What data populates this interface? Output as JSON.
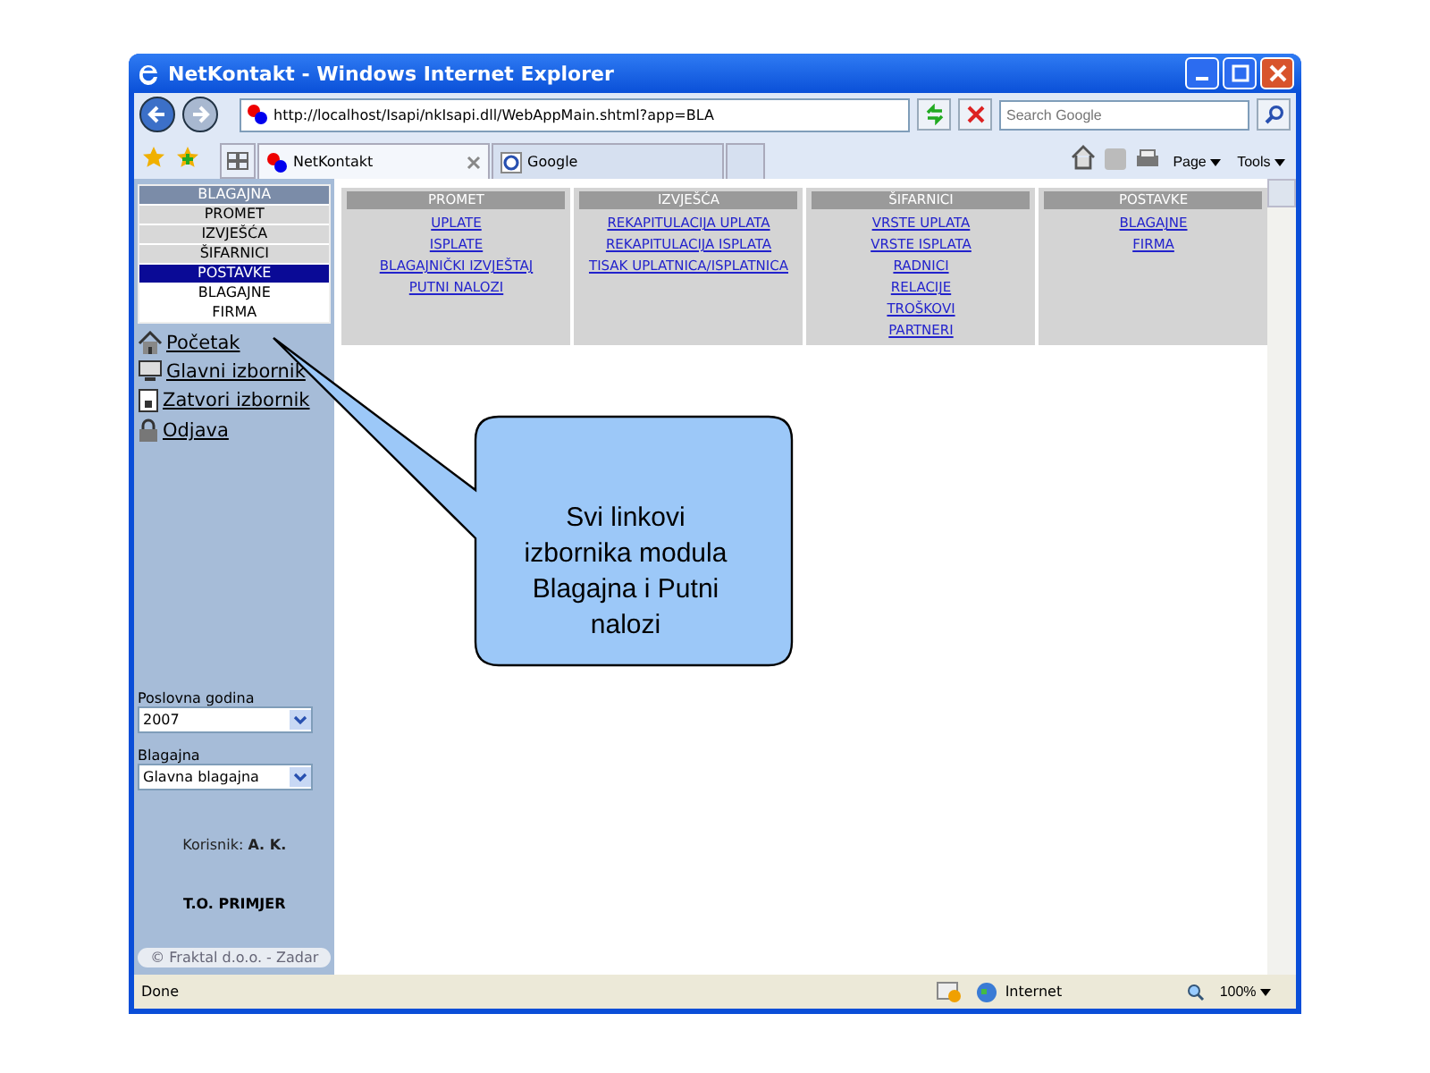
{
  "window": {
    "title": "NetKontakt - Windows Internet Explorer"
  },
  "address_bar": {
    "url": "http://localhost/Isapi/nkIsapi.dll/WebAppMain.shtml?app=BLA",
    "search_placeholder": "Search Google"
  },
  "tabs": [
    {
      "label": "NetKontakt",
      "selected": true,
      "closable": true
    },
    {
      "label": "Google",
      "selected": false,
      "closable": false
    }
  ],
  "toolbar": {
    "buttons": [
      "Page",
      "Tools"
    ]
  },
  "sidebar": {
    "title": "BLAGAJNA",
    "menu": [
      {
        "label": "PROMET",
        "selected": false
      },
      {
        "label": "IZVJEŠĆA",
        "selected": false
      },
      {
        "label": "ŠIFARNICI",
        "selected": false
      },
      {
        "label": "POSTAVKE",
        "selected": true,
        "children": [
          {
            "label": "BLAGAJNE"
          },
          {
            "label": "FIRMA"
          }
        ]
      }
    ],
    "links": [
      {
        "label": "Početak",
        "kind": "home"
      },
      {
        "label": "Glavni izbornik",
        "kind": "monitor"
      },
      {
        "label": "Zatvori izbornik",
        "kind": "document"
      },
      {
        "label": "Odjava",
        "kind": "lock"
      }
    ],
    "fields": [
      {
        "label": "Poslovna godina",
        "value": "2007"
      },
      {
        "label": "Blagajna",
        "value": "Glavna blagajna"
      }
    ],
    "user": "Korisnik: **A. K.**",
    "company": "T.O. PRIMJER",
    "footer": "© Fraktal d.o.o. - Zadar"
  },
  "menu_columns": [
    {
      "title": "PROMET",
      "links": [
        "UPLATE",
        "ISPLATE",
        "BLAGAJNIČKI IZVJEŠTAJ",
        "PUTNI NALOZI"
      ]
    },
    {
      "title": "IZVJEŠĆA",
      "links": [
        "REKAPITULACIJA UPLATA",
        "REKAPITULACIJA ISPLATA",
        "TISAK UPLATNICA/ISPLATNICA"
      ]
    },
    {
      "title": "ŠIFARNICI",
      "links": [
        "VRSTE UPLATA",
        "VRSTE ISPLATA",
        "RADNICI",
        "RELACIJE",
        "TROŠKOVI",
        "PARTNERI"
      ]
    },
    {
      "title": "POSTAVKE",
      "links": [
        "BLAGAJNE",
        "FIRMA"
      ]
    }
  ],
  "callout": {
    "text": "Svi linkovi izbornika modula Blagajna i Putni nalozi"
  },
  "status_bar": {
    "status": "Done",
    "zone": "Internet",
    "zoom": "100%"
  }
}
